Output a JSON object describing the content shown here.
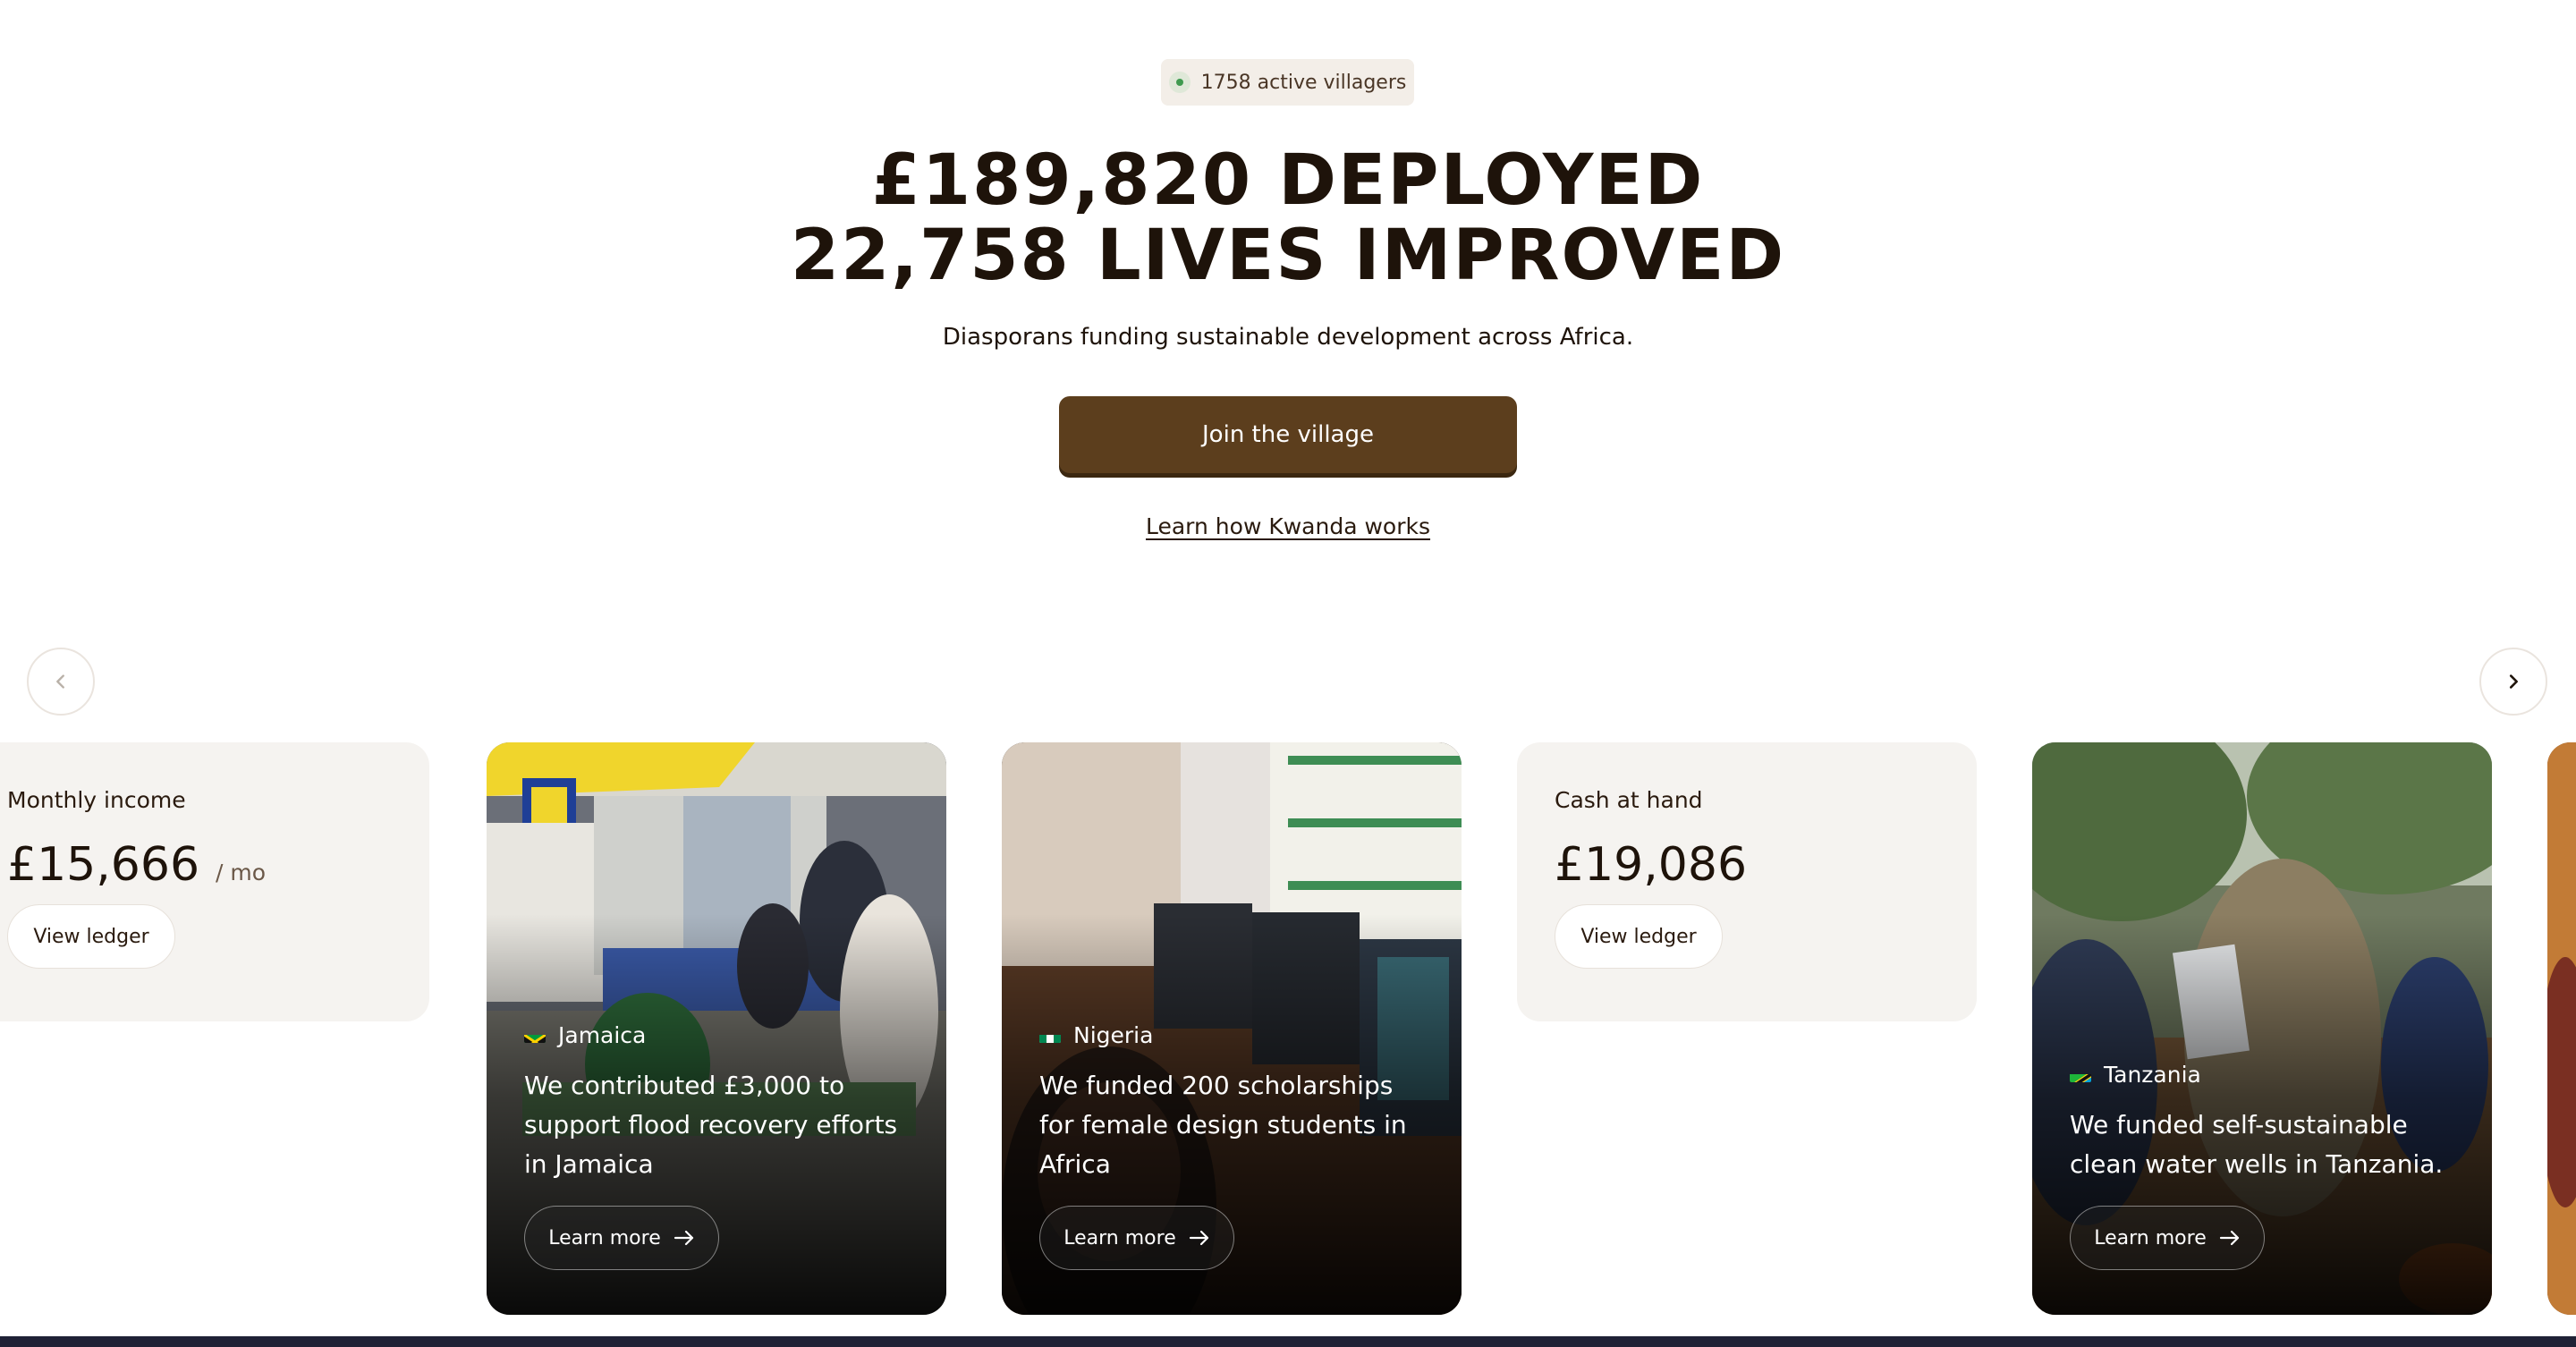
{
  "hero": {
    "badge_text": "1758 active villagers",
    "headline_line1": "£189,820 DEPLOYED",
    "headline_line2": "22,758 LIVES IMPROVED",
    "subtitle": "Diasporans funding sustainable development across Africa.",
    "cta_label": "Join the village",
    "link_label": "Learn how Kwanda works"
  },
  "carousel": {
    "prev_icon": "chevron-left-icon",
    "next_icon": "chevron-right-icon",
    "stats": [
      {
        "label": "Monthly income",
        "value": "£15,666",
        "suffix": "/ mo",
        "button": "View ledger"
      },
      {
        "label": "Cash at hand",
        "value": "£19,086",
        "button": "View ledger"
      }
    ],
    "stories": [
      {
        "country": "Jamaica",
        "text": "We contributed £3,000 to support flood recovery efforts in Jamaica",
        "button": "Learn more"
      },
      {
        "country": "Nigeria",
        "text": "We funded 200 scholarships for female design students in Africa",
        "button": "Learn more"
      },
      {
        "country": "Tanzania",
        "text": "We funded self-sustainable clean water wells in Tanzania.",
        "button": "Learn more"
      }
    ]
  },
  "colors": {
    "brand_brown": "#5c3e1d",
    "text_dark": "#1e130a",
    "card_bg": "#f5f3f0",
    "badge_bg": "#f3eee8",
    "active_dot": "#3f9a4f"
  }
}
